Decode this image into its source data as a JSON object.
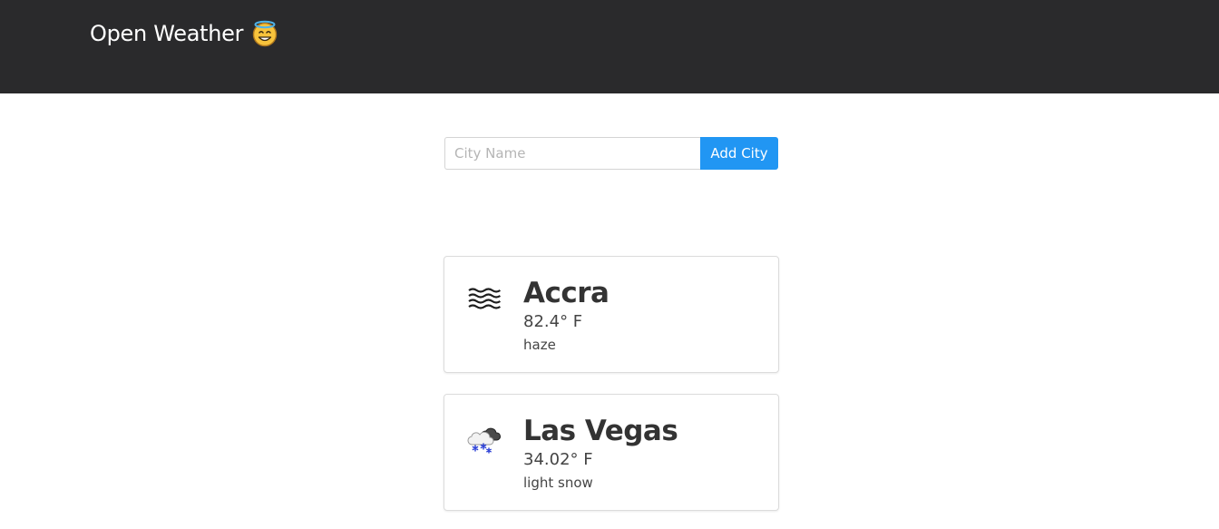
{
  "header": {
    "title": "Open Weather",
    "emoji_icon": "smiling-face-with-halo-icon",
    "background_color": "#2a2a2c"
  },
  "search": {
    "placeholder": "City Name",
    "value": "",
    "button_label": "Add City",
    "button_color": "#2196f3"
  },
  "cities": [
    {
      "name": "Accra",
      "temperature": "82.4° F",
      "description": "haze",
      "icon": "haze-icon"
    },
    {
      "name": "Las Vegas",
      "temperature": "34.02° F",
      "description": "light snow",
      "icon": "light-snow-icon"
    }
  ]
}
